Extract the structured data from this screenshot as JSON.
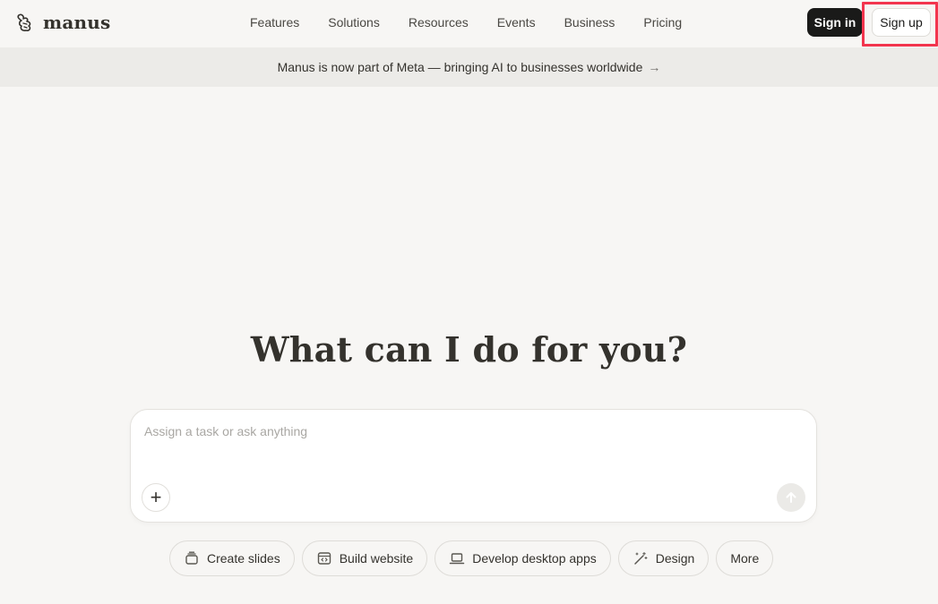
{
  "header": {
    "logo_text": "manus",
    "nav": [
      "Features",
      "Solutions",
      "Resources",
      "Events",
      "Business",
      "Pricing"
    ],
    "sign_in": "Sign in",
    "sign_up": "Sign up"
  },
  "banner": {
    "text": "Manus is now part of Meta — bringing AI to businesses worldwide",
    "arrow": "→"
  },
  "main": {
    "headline": "What can I do for you?",
    "input_placeholder": "Assign a task or ask anything",
    "plus_label": "+"
  },
  "chips": [
    {
      "label": "Create slides",
      "icon": "slides-icon"
    },
    {
      "label": "Build website",
      "icon": "website-icon"
    },
    {
      "label": "Develop desktop apps",
      "icon": "laptop-icon"
    },
    {
      "label": "Design",
      "icon": "design-icon"
    },
    {
      "label": "More",
      "icon": ""
    }
  ],
  "colors": {
    "background": "#f7f6f4",
    "banner": "#ecebe8",
    "sign_in_bg": "#1a1a19",
    "highlight": "#f2354e"
  }
}
